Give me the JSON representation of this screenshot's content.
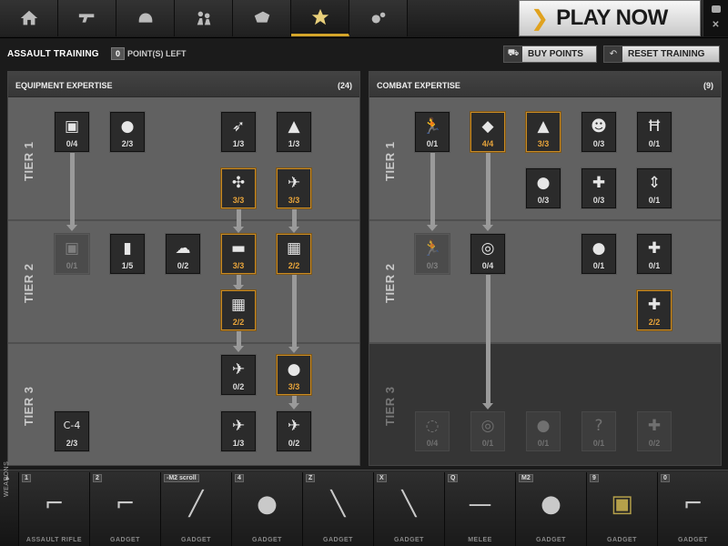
{
  "nav": {
    "tabs": [
      {
        "icon": "home-icon",
        "active": false
      },
      {
        "icon": "pistol-icon",
        "active": false
      },
      {
        "icon": "helmet-icon",
        "active": false
      },
      {
        "icon": "soldiers-icon",
        "active": false
      },
      {
        "icon": "vehicle-icon",
        "active": false
      },
      {
        "icon": "star-icon",
        "active": true
      },
      {
        "icon": "gears-icon",
        "active": false
      }
    ],
    "play_now": "PLAY NOW",
    "play_chevron": "❯"
  },
  "toolbar": {
    "title": "ASSAULT TRAINING",
    "points_value": "0",
    "points_label": "POINT(S) LEFT",
    "buy_points": "BUY POINTS",
    "reset_training": "RESET TRAINING"
  },
  "equipment": {
    "title": "EQUIPMENT EXPERTISE",
    "count": "(24)",
    "tiers": [
      "TIER 1",
      "TIER 2",
      "TIER 3"
    ],
    "skills": [
      {
        "name": "supply-crate",
        "glyph": "▣",
        "count": "0/4"
      },
      {
        "name": "grenade",
        "glyph": "●",
        "count": "2/3"
      },
      {
        "name": "missile",
        "glyph": "➶",
        "count": "1/3"
      },
      {
        "name": "tank-front",
        "glyph": "▲",
        "count": "1/3"
      },
      {
        "name": "helicopter",
        "glyph": "✣",
        "count": "3/3"
      },
      {
        "name": "jet",
        "glyph": "✈",
        "count": "3/3"
      },
      {
        "name": "supply-crate-2",
        "glyph": "▣",
        "count": "0/1"
      },
      {
        "name": "spray",
        "glyph": "▮",
        "count": "1/5"
      },
      {
        "name": "smoke-timer",
        "glyph": "☁",
        "count": "0/2"
      },
      {
        "name": "tank",
        "glyph": "▬",
        "count": "3/3"
      },
      {
        "name": "armor-grid",
        "glyph": "▦",
        "count": "2/2"
      },
      {
        "name": "armor-grid-2",
        "glyph": "▦",
        "count": "2/2"
      },
      {
        "name": "airfield",
        "glyph": "✈",
        "count": "0/2"
      },
      {
        "name": "bomb",
        "glyph": "●",
        "count": "3/3"
      },
      {
        "name": "c4",
        "glyph": "C-4",
        "count": "2/3"
      },
      {
        "name": "jet-2",
        "glyph": "✈",
        "count": "1/3"
      },
      {
        "name": "jet-3",
        "glyph": "✈",
        "count": "0/2"
      }
    ]
  },
  "combat": {
    "title": "COMBAT EXPERTISE",
    "count": "(9)",
    "tiers": [
      "TIER 1",
      "TIER 2",
      "TIER 3"
    ],
    "skills": [
      {
        "name": "sprint",
        "glyph": "🏃",
        "count": "0/1"
      },
      {
        "name": "tag",
        "glyph": "◆",
        "count": "4/4"
      },
      {
        "name": "squad",
        "glyph": "▲",
        "count": "3/3"
      },
      {
        "name": "profile",
        "glyph": "☻",
        "count": "0/3"
      },
      {
        "name": "ladder",
        "glyph": "Ħ",
        "count": "0/1"
      },
      {
        "name": "grenade-signal",
        "glyph": "●",
        "count": "0/3"
      },
      {
        "name": "health",
        "glyph": "✚",
        "count": "0/3"
      },
      {
        "name": "range",
        "glyph": "⇕",
        "count": "0/1"
      },
      {
        "name": "sprint-2",
        "glyph": "🏃",
        "count": "0/3"
      },
      {
        "name": "target-tag",
        "glyph": "◎",
        "count": "0/4"
      },
      {
        "name": "grenade-signal-2",
        "glyph": "●",
        "count": "0/1"
      },
      {
        "name": "medic-run",
        "glyph": "✚",
        "count": "0/1"
      },
      {
        "name": "medic-run-2",
        "glyph": "✚",
        "count": "2/2"
      },
      {
        "name": "signal",
        "glyph": "◌",
        "count": "0/4"
      },
      {
        "name": "target-signal",
        "glyph": "◎",
        "count": "0/1"
      },
      {
        "name": "grenade-3",
        "glyph": "●",
        "count": "0/1"
      },
      {
        "name": "mystery",
        "glyph": "?",
        "count": "0/1"
      },
      {
        "name": "health-2",
        "glyph": "✚",
        "count": "0/2"
      }
    ]
  },
  "weapons": {
    "label": "WEAPONS",
    "caret": "▲",
    "slots": [
      {
        "key": "1",
        "name": "assault-rifle",
        "glyph": "⌐",
        "category": "ASSAULT RIFLE"
      },
      {
        "key": "2",
        "name": "pistol",
        "glyph": "⌐",
        "category": "GADGET"
      },
      {
        "key": "-M2 scroll",
        "name": "shotgun",
        "glyph": "╱",
        "category": "GADGET"
      },
      {
        "key": "4",
        "name": "grenade",
        "glyph": "●",
        "category": "GADGET"
      },
      {
        "key": "Z",
        "name": "syringe",
        "glyph": "╲",
        "category": "GADGET"
      },
      {
        "key": "X",
        "name": "flare",
        "glyph": "╲",
        "category": "GADGET"
      },
      {
        "key": "Q",
        "name": "knife",
        "glyph": "—",
        "category": "MELEE"
      },
      {
        "key": "M2",
        "name": "grenade-2",
        "glyph": "●",
        "category": "GADGET"
      },
      {
        "key": "9",
        "name": "ammo-box",
        "glyph": "▣",
        "category": "GADGET"
      },
      {
        "key": "0",
        "name": "rifle",
        "glyph": "⌐",
        "category": "GADGET"
      }
    ]
  },
  "colors": {
    "accent_gold": "#c98b24",
    "panel_bg": "#616161",
    "top_bar": "#222222"
  }
}
